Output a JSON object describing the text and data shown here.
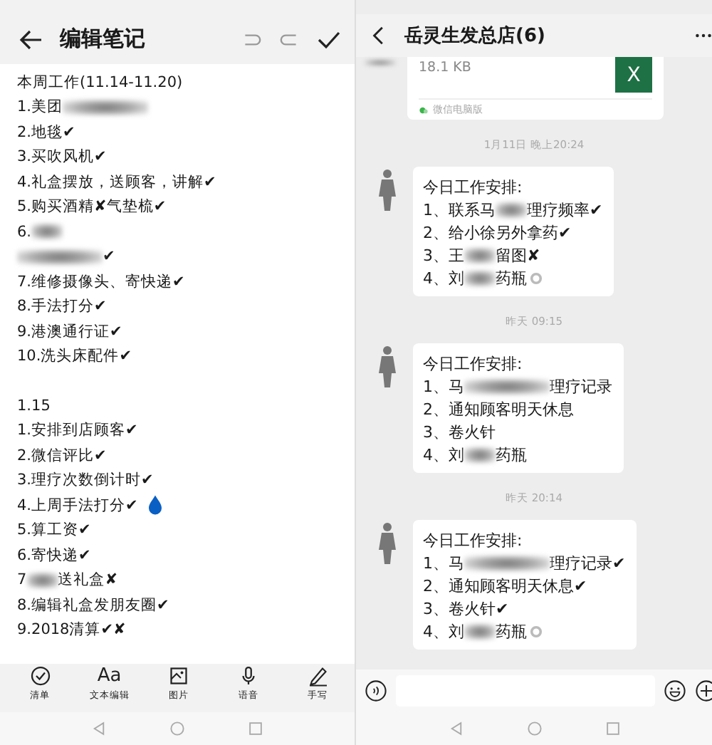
{
  "note_editor": {
    "title": "编辑笔记",
    "sections": [
      {
        "heading": "本周工作(11.14-11.20)",
        "lines": [
          [
            {
              "kind": "text",
              "text": "1.美团"
            },
            {
              "kind": "blur_long"
            }
          ],
          [
            {
              "kind": "text",
              "text": "2.地毯✔"
            }
          ],
          [
            {
              "kind": "text",
              "text": "3.买吹风机✔"
            }
          ],
          [
            {
              "kind": "text",
              "text": "4.礼盒摆放，送顾客，讲解✔"
            }
          ],
          [
            {
              "kind": "text",
              "text": "5.购买酒精✘气垫梳✔"
            }
          ],
          [
            {
              "kind": "text",
              "text": "6."
            },
            {
              "kind": "blur"
            }
          ],
          [
            {
              "kind": "blur_long"
            },
            {
              "kind": "text",
              "text": "✔"
            }
          ],
          [
            {
              "kind": "text",
              "text": "7.维修摄像头、寄快递✔"
            }
          ],
          [
            {
              "kind": "text",
              "text": "8.手法打分✔"
            }
          ],
          [
            {
              "kind": "text",
              "text": "9.港澳通行证✔"
            }
          ],
          [
            {
              "kind": "text",
              "text": "10.洗头床配件✔"
            }
          ]
        ]
      },
      {
        "heading": "1.15",
        "lines": [
          [
            {
              "kind": "text",
              "text": "1.安排到店顾客✔"
            }
          ],
          [
            {
              "kind": "text",
              "text": "2.微信评比✔"
            }
          ],
          [
            {
              "kind": "text",
              "text": "3.理疗次数倒计时✔"
            }
          ],
          [
            {
              "kind": "text",
              "text": "4.上周手法打分✔"
            },
            {
              "kind": "drop"
            }
          ],
          [
            {
              "kind": "text",
              "text": "5.算工资✔"
            }
          ],
          [
            {
              "kind": "text",
              "text": "6.寄快递✔"
            }
          ],
          [
            {
              "kind": "text",
              "text": "7"
            },
            {
              "kind": "blur"
            },
            {
              "kind": "text",
              "text": "送礼盒✘"
            }
          ],
          [
            {
              "kind": "text",
              "text": "8.编辑礼盒发朋友圈✔"
            }
          ],
          [
            {
              "kind": "text",
              "text": "9.2018清算✔✘"
            }
          ]
        ]
      }
    ],
    "toolbar": [
      {
        "kind": "checklist",
        "label": "清单"
      },
      {
        "kind": "text",
        "glyph": "Aa",
        "label": "文本编辑"
      },
      {
        "kind": "image",
        "label": "图片"
      },
      {
        "kind": "voice",
        "label": "语音"
      },
      {
        "kind": "pen",
        "label": "手写"
      }
    ]
  },
  "chat": {
    "title": "岳灵生发总店(6)",
    "file_card": {
      "size": "18.1 KB",
      "badge": "X",
      "source": "微信电脑版"
    },
    "messages": [
      {
        "kind": "time",
        "text": "1月11日 晚上20:24"
      },
      {
        "kind": "bubble",
        "lines": [
          [
            {
              "kind": "text",
              "text": "今日工作安排:"
            }
          ],
          [
            {
              "kind": "text",
              "text": "1、联系马"
            },
            {
              "kind": "blur"
            },
            {
              "kind": "text",
              "text": "理疗频率✔"
            }
          ],
          [
            {
              "kind": "text",
              "text": "2、给小徐另外拿药✔"
            }
          ],
          [
            {
              "kind": "text",
              "text": "3、王"
            },
            {
              "kind": "blur"
            },
            {
              "kind": "text",
              "text": "留图✘"
            }
          ],
          [
            {
              "kind": "text",
              "text": "4、刘"
            },
            {
              "kind": "blur"
            },
            {
              "kind": "text",
              "text": "药瓶"
            },
            {
              "kind": "ring"
            }
          ]
        ]
      },
      {
        "kind": "time",
        "text": "昨天 09:15"
      },
      {
        "kind": "bubble",
        "lines": [
          [
            {
              "kind": "text",
              "text": "今日工作安排:"
            }
          ],
          [
            {
              "kind": "text",
              "text": "1、马"
            },
            {
              "kind": "blur_long"
            },
            {
              "kind": "text",
              "text": "理疗记录"
            }
          ],
          [
            {
              "kind": "text",
              "text": "2、通知顾客明天休息"
            }
          ],
          [
            {
              "kind": "text",
              "text": "3、卷火针"
            }
          ],
          [
            {
              "kind": "text",
              "text": "4、刘"
            },
            {
              "kind": "blur"
            },
            {
              "kind": "text",
              "text": "药瓶"
            }
          ]
        ]
      },
      {
        "kind": "time",
        "text": "昨天 20:14"
      },
      {
        "kind": "bubble",
        "lines": [
          [
            {
              "kind": "text",
              "text": "今日工作安排:"
            }
          ],
          [
            {
              "kind": "text",
              "text": "1、马"
            },
            {
              "kind": "blur_long"
            },
            {
              "kind": "text",
              "text": "理疗记录✔"
            }
          ],
          [
            {
              "kind": "text",
              "text": "2、通知顾客明天休息✔"
            }
          ],
          [
            {
              "kind": "text",
              "text": "3、卷火针✔"
            }
          ],
          [
            {
              "kind": "text",
              "text": "4、刘"
            },
            {
              "kind": "blur"
            },
            {
              "kind": "text",
              "text": "药瓶"
            },
            {
              "kind": "ring"
            }
          ]
        ]
      }
    ]
  }
}
